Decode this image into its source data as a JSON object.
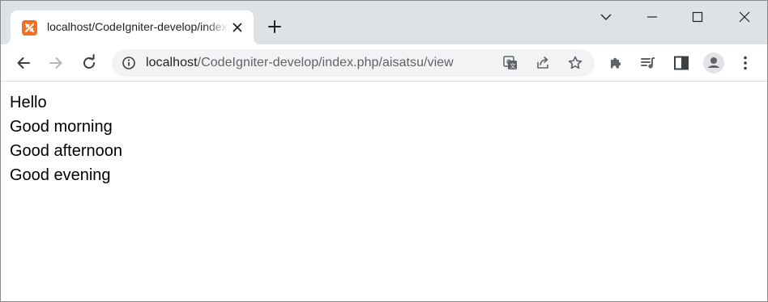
{
  "tab": {
    "title": "localhost/CodeIgniter-develop/index.php/aisatsu/view",
    "favicon": "xampp-icon"
  },
  "omnibox": {
    "host": "localhost",
    "path": "/CodeIgniter-develop/index.php/aisatsu/view"
  },
  "content": {
    "lines": [
      "Hello",
      "Good morning",
      "Good afternoon",
      "Good evening"
    ]
  },
  "colors": {
    "tabstrip": "#dee1e6",
    "favicon": "#f36f21",
    "icon": "#5f6368"
  }
}
